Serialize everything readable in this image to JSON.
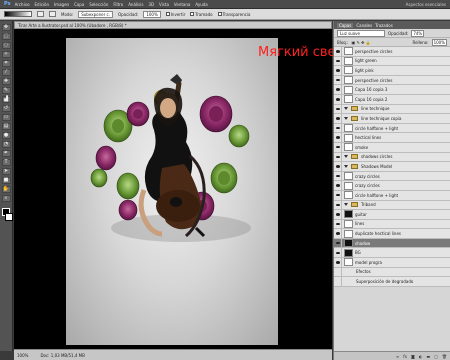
{
  "menubar": {
    "logo": "Ps",
    "items": [
      "Archivo",
      "Edición",
      "Imagen",
      "Capa",
      "Selección",
      "Filtro",
      "Análisis",
      "3D",
      "Vista",
      "Ventana",
      "Ayuda"
    ],
    "workspace": "Aspectos esenciales"
  },
  "options": {
    "mode_label": "Modo:",
    "mode_value": "Subexponer c.",
    "opacity_label": "Opacidad:",
    "opacity_value": "100%",
    "invert": "Invertir",
    "dither": "Tramado",
    "transparency": "Transparencia"
  },
  "document": {
    "title": "Tirar Arte a Ilustrator.psd al 100% (Ubadore , RGB/8) *"
  },
  "status": {
    "zoom": "100%",
    "doc": "Doc: 1,03 MB/51,4 MB"
  },
  "overlay_title": "Мягкий свет",
  "layers_panel": {
    "tabs": [
      "Capas",
      "Canales",
      "Trazados"
    ],
    "blend_mode": "Luz suave",
    "opacity_label": "Opacidad:",
    "opacity_value": "74%",
    "lock_label": "Bloq.:",
    "fill_label": "Relleno:",
    "fill_value": "100%",
    "layers": [
      {
        "name": "perspective circles",
        "kind": "layer"
      },
      {
        "name": "light green",
        "kind": "layer"
      },
      {
        "name": "light pink",
        "kind": "layer"
      },
      {
        "name": "perspective circles",
        "kind": "layer"
      },
      {
        "name": "Capa 16 copia 3",
        "kind": "layer"
      },
      {
        "name": "Capa 16 copia 2",
        "kind": "layer"
      },
      {
        "name": "line technique",
        "kind": "group"
      },
      {
        "name": "line technique copia",
        "kind": "group"
      },
      {
        "name": "circle halftone + light",
        "kind": "layer"
      },
      {
        "name": "hectical lines",
        "kind": "layer"
      },
      {
        "name": "smoke",
        "kind": "layer"
      },
      {
        "name": "shadows circles",
        "kind": "group"
      },
      {
        "name": "Shadows Model",
        "kind": "group"
      },
      {
        "name": "crazy circles",
        "kind": "layer"
      },
      {
        "name": "crazy circles",
        "kind": "layer"
      },
      {
        "name": "circle halftone + light",
        "kind": "layer"
      },
      {
        "name": "Triband",
        "kind": "group"
      },
      {
        "name": "guitar",
        "kind": "layer-black"
      },
      {
        "name": "lines",
        "kind": "layer"
      },
      {
        "name": "duplicate hectical lines",
        "kind": "layer"
      },
      {
        "name": "shadow",
        "kind": "layer-black",
        "selected": true
      },
      {
        "name": "BG",
        "kind": "layer-black"
      },
      {
        "name": "model progra",
        "kind": "layer"
      },
      {
        "name": "Efectos",
        "kind": "effect"
      },
      {
        "name": "Superposición de degradado",
        "kind": "effect"
      }
    ]
  },
  "chart_data": null
}
